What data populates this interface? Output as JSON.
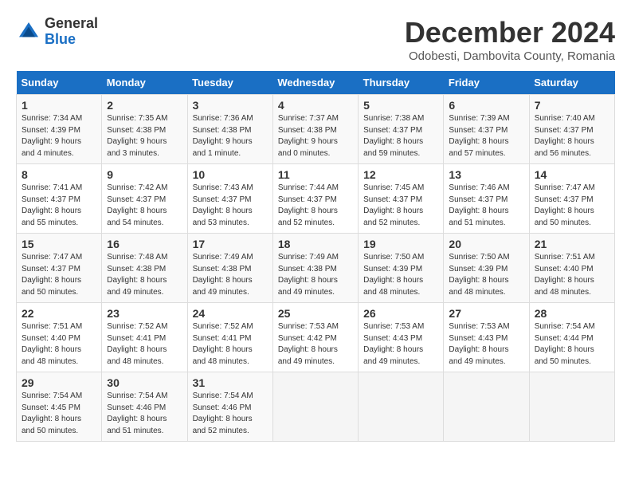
{
  "logo": {
    "general": "General",
    "blue": "Blue"
  },
  "title": "December 2024",
  "location": "Odobesti, Dambovita County, Romania",
  "days_header": [
    "Sunday",
    "Monday",
    "Tuesday",
    "Wednesday",
    "Thursday",
    "Friday",
    "Saturday"
  ],
  "weeks": [
    [
      {
        "day": "1",
        "info": "Sunrise: 7:34 AM\nSunset: 4:39 PM\nDaylight: 9 hours\nand 4 minutes."
      },
      {
        "day": "2",
        "info": "Sunrise: 7:35 AM\nSunset: 4:38 PM\nDaylight: 9 hours\nand 3 minutes."
      },
      {
        "day": "3",
        "info": "Sunrise: 7:36 AM\nSunset: 4:38 PM\nDaylight: 9 hours\nand 1 minute."
      },
      {
        "day": "4",
        "info": "Sunrise: 7:37 AM\nSunset: 4:38 PM\nDaylight: 9 hours\nand 0 minutes."
      },
      {
        "day": "5",
        "info": "Sunrise: 7:38 AM\nSunset: 4:37 PM\nDaylight: 8 hours\nand 59 minutes."
      },
      {
        "day": "6",
        "info": "Sunrise: 7:39 AM\nSunset: 4:37 PM\nDaylight: 8 hours\nand 57 minutes."
      },
      {
        "day": "7",
        "info": "Sunrise: 7:40 AM\nSunset: 4:37 PM\nDaylight: 8 hours\nand 56 minutes."
      }
    ],
    [
      {
        "day": "8",
        "info": "Sunrise: 7:41 AM\nSunset: 4:37 PM\nDaylight: 8 hours\nand 55 minutes."
      },
      {
        "day": "9",
        "info": "Sunrise: 7:42 AM\nSunset: 4:37 PM\nDaylight: 8 hours\nand 54 minutes."
      },
      {
        "day": "10",
        "info": "Sunrise: 7:43 AM\nSunset: 4:37 PM\nDaylight: 8 hours\nand 53 minutes."
      },
      {
        "day": "11",
        "info": "Sunrise: 7:44 AM\nSunset: 4:37 PM\nDaylight: 8 hours\nand 52 minutes."
      },
      {
        "day": "12",
        "info": "Sunrise: 7:45 AM\nSunset: 4:37 PM\nDaylight: 8 hours\nand 52 minutes."
      },
      {
        "day": "13",
        "info": "Sunrise: 7:46 AM\nSunset: 4:37 PM\nDaylight: 8 hours\nand 51 minutes."
      },
      {
        "day": "14",
        "info": "Sunrise: 7:47 AM\nSunset: 4:37 PM\nDaylight: 8 hours\nand 50 minutes."
      }
    ],
    [
      {
        "day": "15",
        "info": "Sunrise: 7:47 AM\nSunset: 4:37 PM\nDaylight: 8 hours\nand 50 minutes."
      },
      {
        "day": "16",
        "info": "Sunrise: 7:48 AM\nSunset: 4:38 PM\nDaylight: 8 hours\nand 49 minutes."
      },
      {
        "day": "17",
        "info": "Sunrise: 7:49 AM\nSunset: 4:38 PM\nDaylight: 8 hours\nand 49 minutes."
      },
      {
        "day": "18",
        "info": "Sunrise: 7:49 AM\nSunset: 4:38 PM\nDaylight: 8 hours\nand 49 minutes."
      },
      {
        "day": "19",
        "info": "Sunrise: 7:50 AM\nSunset: 4:39 PM\nDaylight: 8 hours\nand 48 minutes."
      },
      {
        "day": "20",
        "info": "Sunrise: 7:50 AM\nSunset: 4:39 PM\nDaylight: 8 hours\nand 48 minutes."
      },
      {
        "day": "21",
        "info": "Sunrise: 7:51 AM\nSunset: 4:40 PM\nDaylight: 8 hours\nand 48 minutes."
      }
    ],
    [
      {
        "day": "22",
        "info": "Sunrise: 7:51 AM\nSunset: 4:40 PM\nDaylight: 8 hours\nand 48 minutes."
      },
      {
        "day": "23",
        "info": "Sunrise: 7:52 AM\nSunset: 4:41 PM\nDaylight: 8 hours\nand 48 minutes."
      },
      {
        "day": "24",
        "info": "Sunrise: 7:52 AM\nSunset: 4:41 PM\nDaylight: 8 hours\nand 48 minutes."
      },
      {
        "day": "25",
        "info": "Sunrise: 7:53 AM\nSunset: 4:42 PM\nDaylight: 8 hours\nand 49 minutes."
      },
      {
        "day": "26",
        "info": "Sunrise: 7:53 AM\nSunset: 4:43 PM\nDaylight: 8 hours\nand 49 minutes."
      },
      {
        "day": "27",
        "info": "Sunrise: 7:53 AM\nSunset: 4:43 PM\nDaylight: 8 hours\nand 49 minutes."
      },
      {
        "day": "28",
        "info": "Sunrise: 7:54 AM\nSunset: 4:44 PM\nDaylight: 8 hours\nand 50 minutes."
      }
    ],
    [
      {
        "day": "29",
        "info": "Sunrise: 7:54 AM\nSunset: 4:45 PM\nDaylight: 8 hours\nand 50 minutes."
      },
      {
        "day": "30",
        "info": "Sunrise: 7:54 AM\nSunset: 4:46 PM\nDaylight: 8 hours\nand 51 minutes."
      },
      {
        "day": "31",
        "info": "Sunrise: 7:54 AM\nSunset: 4:46 PM\nDaylight: 8 hours\nand 52 minutes."
      },
      {
        "day": "",
        "info": ""
      },
      {
        "day": "",
        "info": ""
      },
      {
        "day": "",
        "info": ""
      },
      {
        "day": "",
        "info": ""
      }
    ]
  ]
}
